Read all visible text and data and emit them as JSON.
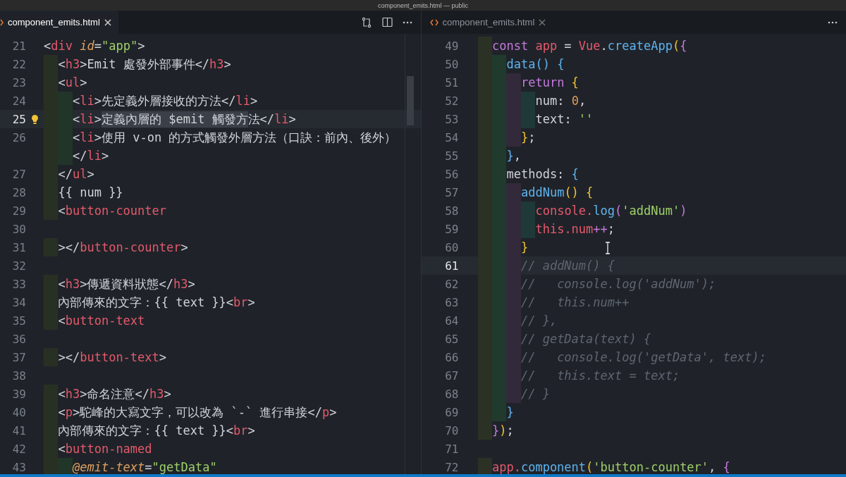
{
  "window": {
    "title": "component_emits.html — public"
  },
  "panes": [
    {
      "tab": {
        "label": "component_emits.html",
        "selected": true
      },
      "lines": [
        {
          "number": "21",
          "current": false,
          "tokens": [
            {
              "text": "<",
              "kind": "p"
            },
            {
              "text": "div",
              "kind": "tag"
            },
            {
              "text": " id",
              "kind": "attr"
            },
            {
              "text": "=",
              "kind": "p"
            },
            {
              "text": "\"app\"",
              "kind": "string"
            },
            {
              "text": ">",
              "kind": "p"
            }
          ]
        },
        {
          "number": "22",
          "current": false,
          "tokens": [
            {
              "text": "  <",
              "kind": "p"
            },
            {
              "text": "h3",
              "kind": "tag"
            },
            {
              "text": ">Emit 處發外部事件</",
              "kind": "p"
            },
            {
              "text": "h3",
              "kind": "tag"
            },
            {
              "text": ">",
              "kind": "p"
            }
          ]
        },
        {
          "number": "23",
          "current": false,
          "tokens": [
            {
              "text": "  <",
              "kind": "p"
            },
            {
              "text": "ul",
              "kind": "tag"
            },
            {
              "text": ">",
              "kind": "p"
            }
          ]
        },
        {
          "number": "24",
          "current": false,
          "tokens": [
            {
              "text": "    <",
              "kind": "p"
            },
            {
              "text": "li",
              "kind": "tag"
            },
            {
              "text": ">先定義外層接收的方法</",
              "kind": "p"
            },
            {
              "text": "li",
              "kind": "tag"
            },
            {
              "text": ">",
              "kind": "p"
            }
          ]
        },
        {
          "number": "25",
          "current": true,
          "hint": true,
          "tokens": [
            {
              "text": "    <",
              "kind": "p"
            },
            {
              "text": "li",
              "kind": "tag"
            },
            {
              "text": ">",
              "kind": "p"
            },
            {
              "text": "定義內層的 $emit 觸發方",
              "kind": "selected"
            },
            {
              "text": "法</",
              "kind": "p"
            },
            {
              "text": "li",
              "kind": "tag"
            },
            {
              "text": ">",
              "kind": "p"
            }
          ]
        },
        {
          "number": "26",
          "current": false,
          "tokens": [
            {
              "text": "    <",
              "kind": "p"
            },
            {
              "text": "li",
              "kind": "tag"
            },
            {
              "text": ">使用 v-on 的方式觸發外層方法（口訣：前內、後外）",
              "kind": "p"
            }
          ]
        },
        {
          "tokens": [
            {
              "text": "    </",
              "kind": "p"
            },
            {
              "text": "li",
              "kind": "tag"
            },
            {
              "text": ">",
              "kind": "p"
            }
          ]
        },
        {
          "number": "27",
          "current": false,
          "tokens": [
            {
              "text": "  </",
              "kind": "p"
            },
            {
              "text": "ul",
              "kind": "tag"
            },
            {
              "text": ">",
              "kind": "p"
            }
          ]
        },
        {
          "number": "28",
          "current": false,
          "tokens": [
            {
              "text": "  {{ num }}",
              "kind": "p"
            }
          ]
        },
        {
          "number": "29",
          "current": false,
          "tokens": [
            {
              "text": "  <",
              "kind": "p"
            },
            {
              "text": "button-counter",
              "kind": "tag"
            }
          ]
        },
        {
          "number": "30",
          "current": false
        },
        {
          "number": "31",
          "current": false,
          "tokens": [
            {
              "text": "  ></",
              "kind": "p"
            },
            {
              "text": "button-counter",
              "kind": "tag"
            },
            {
              "text": ">",
              "kind": "p"
            }
          ]
        },
        {
          "number": "32",
          "current": false
        },
        {
          "number": "33",
          "current": false,
          "tokens": [
            {
              "text": "  <",
              "kind": "p"
            },
            {
              "text": "h3",
              "kind": "tag"
            },
            {
              "text": ">傳遞資料狀態</",
              "kind": "p"
            },
            {
              "text": "h3",
              "kind": "tag"
            },
            {
              "text": ">",
              "kind": "p"
            }
          ]
        },
        {
          "number": "34",
          "current": false,
          "tokens": [
            {
              "text": "  內部傳來的文字：{{ text }}<",
              "kind": "p"
            },
            {
              "text": "br",
              "kind": "tag"
            },
            {
              "text": ">",
              "kind": "p"
            }
          ]
        },
        {
          "number": "35",
          "current": false,
          "tokens": [
            {
              "text": "  <",
              "kind": "p"
            },
            {
              "text": "button-text",
              "kind": "tag"
            }
          ]
        },
        {
          "number": "36",
          "current": false
        },
        {
          "number": "37",
          "current": false,
          "tokens": [
            {
              "text": "  ></",
              "kind": "p"
            },
            {
              "text": "button-text",
              "kind": "tag"
            },
            {
              "text": ">",
              "kind": "p"
            }
          ]
        },
        {
          "number": "38",
          "current": false
        },
        {
          "number": "39",
          "current": false,
          "tokens": [
            {
              "text": "  <",
              "kind": "p"
            },
            {
              "text": "h3",
              "kind": "tag"
            },
            {
              "text": ">命名注意</",
              "kind": "p"
            },
            {
              "text": "h3",
              "kind": "tag"
            },
            {
              "text": ">",
              "kind": "p"
            }
          ]
        },
        {
          "number": "40",
          "current": false,
          "tokens": [
            {
              "text": "  <",
              "kind": "p"
            },
            {
              "text": "p",
              "kind": "tag"
            },
            {
              "text": ">駝峰的大寫文字，可以改為 `-` 進行串接</",
              "kind": "p"
            },
            {
              "text": "p",
              "kind": "tag"
            },
            {
              "text": ">",
              "kind": "p"
            }
          ]
        },
        {
          "number": "41",
          "current": false,
          "tokens": [
            {
              "text": "  內部傳來的文字：{{ text }}<",
              "kind": "p"
            },
            {
              "text": "br",
              "kind": "tag"
            },
            {
              "text": ">",
              "kind": "p"
            }
          ]
        },
        {
          "number": "42",
          "current": false,
          "tokens": [
            {
              "text": "  <",
              "kind": "p"
            },
            {
              "text": "button-named",
              "kind": "tag"
            }
          ]
        },
        {
          "number": "43",
          "current": false,
          "tokens": [
            {
              "text": "    @emit-text",
              "kind": "attr"
            },
            {
              "text": "=",
              "kind": "p"
            },
            {
              "text": "\"getData\"",
              "kind": "string"
            }
          ]
        }
      ]
    },
    {
      "tab": {
        "label": "component_emits.html",
        "selected": false
      },
      "lines": [
        {
          "number": "49",
          "current": false,
          "tokens": [
            {
              "text": "  const ",
              "kind": "keyword"
            },
            {
              "text": "app",
              "kind": "var"
            },
            {
              "text": " = ",
              "kind": "p"
            },
            {
              "text": "Vue",
              "kind": "var"
            },
            {
              "text": ".",
              "kind": "p"
            },
            {
              "text": "createApp",
              "kind": "func"
            },
            {
              "text": "(",
              "kind": "brace1"
            },
            {
              "text": "{",
              "kind": "brace2"
            }
          ]
        },
        {
          "number": "50",
          "current": false,
          "tokens": [
            {
              "text": "    data",
              "kind": "func"
            },
            {
              "text": "() {",
              "kind": "brace3"
            }
          ]
        },
        {
          "number": "51",
          "current": false,
          "tokens": [
            {
              "text": "      return ",
              "kind": "keyword"
            },
            {
              "text": "{",
              "kind": "brace1"
            }
          ]
        },
        {
          "number": "52",
          "current": false,
          "tokens": [
            {
              "text": "        num: ",
              "kind": "p"
            },
            {
              "text": "0",
              "kind": "number"
            },
            {
              "text": ",",
              "kind": "p"
            }
          ]
        },
        {
          "number": "53",
          "current": false,
          "tokens": [
            {
              "text": "        text: ",
              "kind": "p"
            },
            {
              "text": "''",
              "kind": "string"
            }
          ]
        },
        {
          "number": "54",
          "current": false,
          "tokens": [
            {
              "text": "      }",
              "kind": "brace1"
            },
            {
              "text": ";",
              "kind": "p"
            }
          ]
        },
        {
          "number": "55",
          "current": false,
          "tokens": [
            {
              "text": "    }",
              "kind": "brace3"
            },
            {
              "text": ",",
              "kind": "p"
            }
          ]
        },
        {
          "number": "56",
          "current": false,
          "tokens": [
            {
              "text": "    methods: ",
              "kind": "p"
            },
            {
              "text": "{",
              "kind": "brace3"
            }
          ]
        },
        {
          "number": "57",
          "current": false,
          "tokens": [
            {
              "text": "      addNum",
              "kind": "func"
            },
            {
              "text": "() {",
              "kind": "brace1"
            }
          ]
        },
        {
          "number": "58",
          "current": false,
          "tokens": [
            {
              "text": "        console.",
              "kind": "var"
            },
            {
              "text": "log",
              "kind": "func"
            },
            {
              "text": "(",
              "kind": "brace2"
            },
            {
              "text": "'addNum'",
              "kind": "string"
            },
            {
              "text": ")",
              "kind": "brace2"
            }
          ]
        },
        {
          "number": "59",
          "current": false,
          "tokens": [
            {
              "text": "        this.num",
              "kind": "var"
            },
            {
              "text": "++",
              "kind": "keyword"
            },
            {
              "text": ";",
              "kind": "p"
            }
          ]
        },
        {
          "number": "60",
          "current": false,
          "tokens": [
            {
              "text": "      }",
              "kind": "brace1"
            }
          ]
        },
        {
          "number": "61",
          "current": true,
          "tokens": [
            {
              "text": "      // addNum() {",
              "kind": "comment"
            }
          ]
        },
        {
          "number": "62",
          "current": false,
          "tokens": [
            {
              "text": "      //   console.log('addNum');",
              "kind": "comment"
            }
          ]
        },
        {
          "number": "63",
          "current": false,
          "tokens": [
            {
              "text": "      //   this.num++",
              "kind": "comment"
            }
          ]
        },
        {
          "number": "64",
          "current": false,
          "tokens": [
            {
              "text": "      // },",
              "kind": "comment"
            }
          ]
        },
        {
          "number": "65",
          "current": false,
          "tokens": [
            {
              "text": "      // getData(text) {",
              "kind": "comment"
            }
          ]
        },
        {
          "number": "66",
          "current": false,
          "tokens": [
            {
              "text": "      //   console.log('getData', text);",
              "kind": "comment"
            }
          ]
        },
        {
          "number": "67",
          "current": false,
          "tokens": [
            {
              "text": "      //   this.text = text;",
              "kind": "comment"
            }
          ]
        },
        {
          "number": "68",
          "current": false,
          "tokens": [
            {
              "text": "      // }",
              "kind": "comment"
            }
          ]
        },
        {
          "number": "69",
          "current": false,
          "tokens": [
            {
              "text": "    }",
              "kind": "brace3"
            }
          ]
        },
        {
          "number": "70",
          "current": false,
          "tokens": [
            {
              "text": "  }",
              "kind": "brace2"
            },
            {
              "text": ")",
              "kind": "brace1"
            },
            {
              "text": ";",
              "kind": "p"
            }
          ]
        },
        {
          "number": "71",
          "current": false
        },
        {
          "number": "72",
          "current": false,
          "tokens": [
            {
              "text": "  app.",
              "kind": "var"
            },
            {
              "text": "component",
              "kind": "func"
            },
            {
              "text": "(",
              "kind": "brace1"
            },
            {
              "text": "'button-counter'",
              "kind": "string"
            },
            {
              "text": ", ",
              "kind": "p"
            },
            {
              "text": "{",
              "kind": "brace2"
            }
          ]
        }
      ]
    }
  ]
}
